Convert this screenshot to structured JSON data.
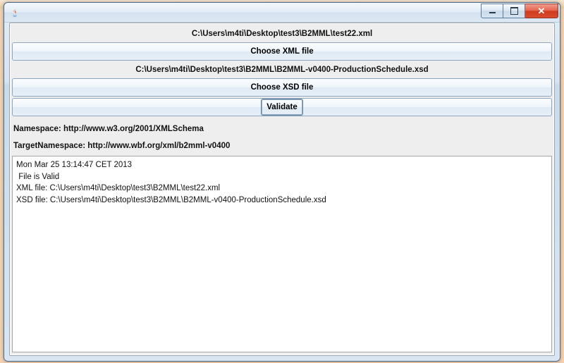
{
  "window": {
    "title": ""
  },
  "paths": {
    "xml": "C:\\Users\\m4ti\\Desktop\\test3\\B2MML\\test22.xml",
    "xsd": "C:\\Users\\m4ti\\Desktop\\test3\\B2MML\\B2MML-v0400-ProductionSchedule.xsd"
  },
  "buttons": {
    "choose_xml": "Choose XML file",
    "choose_xsd": "Choose XSD file",
    "validate": "Validate"
  },
  "labels": {
    "namespace": "Namespace: http://www.w3.org/2001/XMLSchema",
    "target_namespace": "TargetNamespace: http://www.wbf.org/xml/b2mml-v0400"
  },
  "output_lines": [
    "Mon Mar 25 13:14:47 CET 2013",
    " File is Valid",
    "XML file: C:\\Users\\m4ti\\Desktop\\test3\\B2MML\\test22.xml",
    "XSD file: C:\\Users\\m4ti\\Desktop\\test3\\B2MML\\B2MML-v0400-ProductionSchedule.xsd"
  ]
}
